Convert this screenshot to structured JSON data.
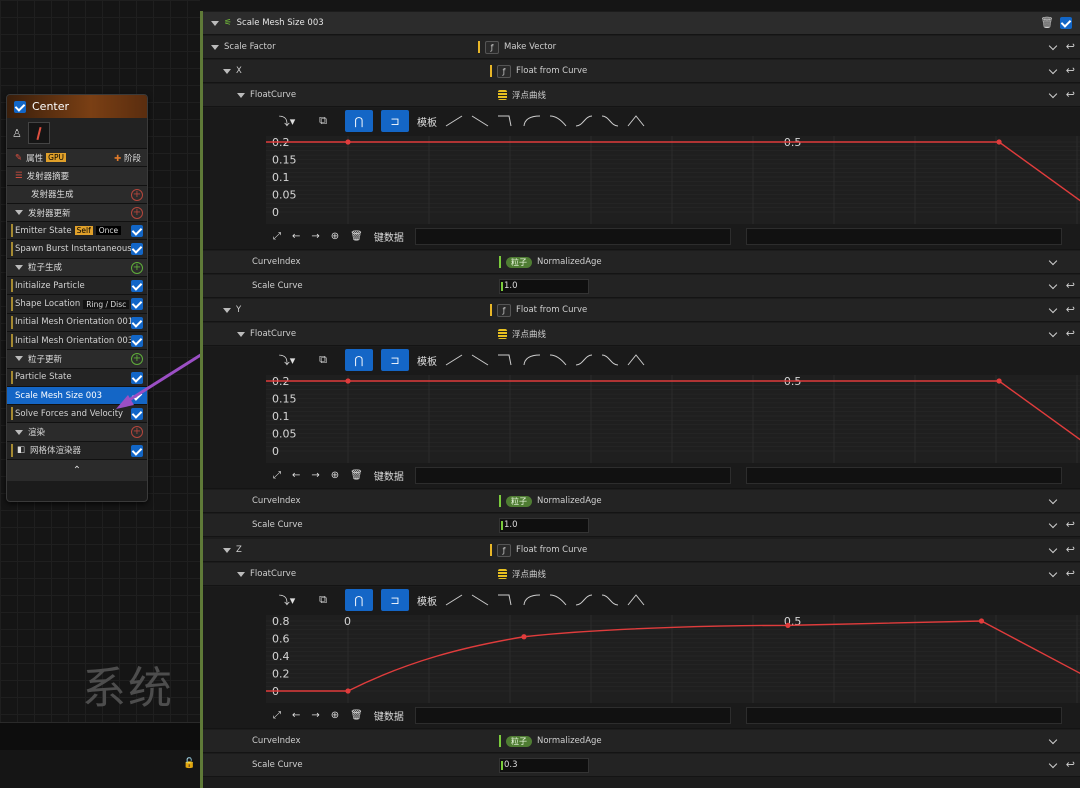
{
  "watermark": "系统",
  "node": {
    "title": "Center",
    "props_label": "属性",
    "gpu_tag": "GPU",
    "stage_button": "阶段",
    "summary": "发射器摘要",
    "emitter_spawn": "发射器生成",
    "emitter_update": "发射器更新",
    "emitter_state": "Emitter State",
    "self_tag": "Self",
    "once_tag": "Once",
    "spawn_burst": "Spawn Burst Instantaneous",
    "particle_spawn": "粒子生成",
    "init_particle": "Initialize Particle",
    "shape_location": "Shape Location",
    "ring_disc": "Ring / Disc",
    "mesh_orient_001": "Initial Mesh Orientation 001",
    "mesh_orient_003": "Initial Mesh Orientation 003",
    "particle_update": "粒子更新",
    "particle_state": "Particle State",
    "scale_mesh": "Scale Mesh Size 003",
    "solve_forces": "Solve Forces and Velocity",
    "render": "渲染",
    "mesh_renderer": "网格体渲染器",
    "collapse": "⌃"
  },
  "panel": {
    "title": "Scale Mesh Size 003",
    "scale_factor": "Scale Factor",
    "make_vector": "Make Vector",
    "float_from_curve": "Float from Curve",
    "float_curve": "FloatCurve",
    "float_curve_cn": "浮点曲线",
    "template": "模板",
    "key_data": "键数据",
    "curve_index": "CurveIndex",
    "particles": "粒子",
    "normalized_age": "NormalizedAge",
    "scale_curve": "Scale Curve",
    "axes": [
      {
        "name": "X",
        "scale_curve": "1.0"
      },
      {
        "name": "Y",
        "scale_curve": "1.0"
      },
      {
        "name": "Z",
        "scale_curve": "0.3"
      }
    ]
  },
  "chart_data": [
    {
      "type": "line",
      "series": [
        {
          "x": [
            0,
            0.74,
            0.85,
            1.0
          ],
          "y": [
            0.2,
            0.2,
            0,
            0
          ]
        }
      ],
      "x_tick_label": "0.5",
      "y_tick_labels": [
        "0.2",
        "0.15",
        "0.1",
        "0.05",
        "0"
      ],
      "ylim": [
        0,
        0.2
      ],
      "line_color": "#e03c3c"
    },
    {
      "type": "line",
      "series": [
        {
          "x": [
            0,
            0.74,
            0.85,
            1.0
          ],
          "y": [
            0.2,
            0.2,
            0,
            0
          ]
        }
      ],
      "x_tick_label": "0.5",
      "y_tick_labels": [
        "0.2",
        "0.15",
        "0.1",
        "0.05",
        "0"
      ],
      "ylim": [
        0,
        0.2
      ],
      "line_color": "#e03c3c"
    },
    {
      "type": "line",
      "series": [
        {
          "x": [
            0,
            0.2,
            0.5,
            0.72,
            0.87,
            1.0
          ],
          "y": [
            0,
            0.62,
            0.75,
            0.8,
            0,
            0
          ]
        }
      ],
      "x_tick_labels": [
        "0",
        "0.5"
      ],
      "y_tick_labels": [
        "0.8",
        "0.6",
        "0.4",
        "0.2",
        "0"
      ],
      "ylim": [
        0,
        0.8
      ],
      "line_color": "#e03c3c"
    }
  ]
}
